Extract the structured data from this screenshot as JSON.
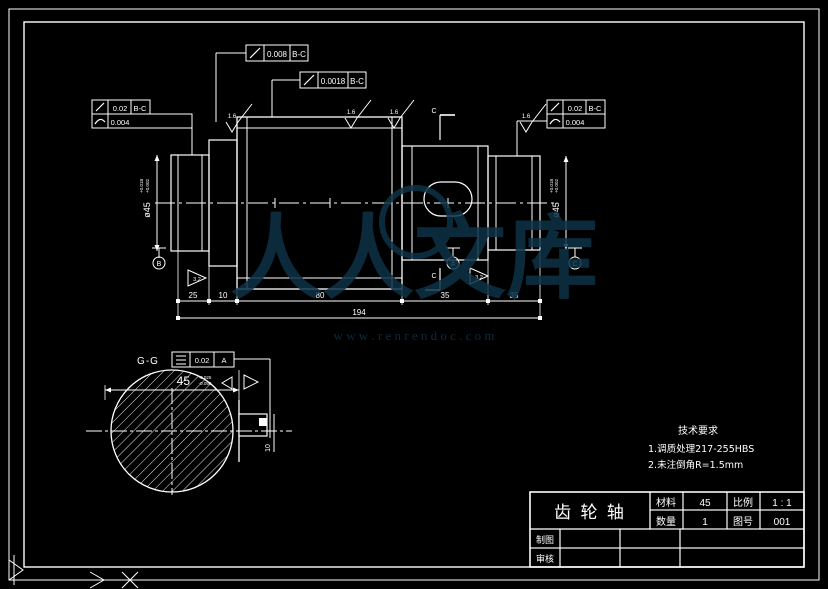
{
  "drawing": {
    "kind": "mechanical-engineering-part-drawing",
    "background_color": "#000000",
    "line_color": "#ffffff",
    "center_line_color": "#ffffff",
    "watermark_color": "#0d3348",
    "border": {
      "outer_label": "drawing-sheet-border",
      "inner_label": "drawing-frame"
    }
  },
  "watermark": {
    "logo_text": "人人文库",
    "url_text": "w w w . r e n r e n d o c . c o m"
  },
  "tolerance_frames": {
    "top_left": {
      "symbol": "⟋",
      "value": "0.008",
      "datum": "B-C"
    },
    "top_mid": {
      "symbol": "⟋",
      "value": "0.0018",
      "datum": "B-C"
    },
    "left_upper": {
      "symbol": "⟋",
      "value": "0.02",
      "datum": "B-C"
    },
    "left_lower": {
      "symbol": "⌓",
      "value": "0.004",
      "datum": ""
    },
    "right_upper": {
      "symbol": "⟋",
      "value": "0.02",
      "datum": "B-C"
    },
    "right_lower": {
      "symbol": "⌓",
      "value": "0.004",
      "datum": ""
    },
    "section_frame": {
      "symbol": "≡",
      "value": "0.02",
      "datum": "A"
    }
  },
  "datums": {
    "left": "B",
    "center": "A",
    "right": "C",
    "section_cut_left": "C",
    "section_cut_right": "C",
    "section_label": "G-G",
    "section_mark_left": "G",
    "section_mark_right": "G"
  },
  "surface_finish": {
    "values": [
      "1.6",
      "1.6",
      "1.6",
      "1.6",
      "3.2",
      "3.2"
    ],
    "symbol": "▽"
  },
  "dimensions": {
    "horizontal": [
      {
        "label": "25",
        "name": "dim-25"
      },
      {
        "label": "10",
        "name": "dim-10"
      },
      {
        "label": "80",
        "name": "dim-80"
      },
      {
        "label": "35",
        "name": "dim-35-a"
      },
      {
        "label": "35",
        "name": "dim-35-b"
      },
      {
        "label": "194",
        "name": "dim-overall-194"
      }
    ],
    "vertical_left": {
      "label": "ø45",
      "tolerance": "+0.018\n+0.002"
    },
    "vertical_right": {
      "label": "ø45",
      "tolerance": "+0.018\n+0.002"
    },
    "section_width": {
      "label": "45",
      "tolerance": "-0.025\n-0.050"
    },
    "keyway_depth": {
      "label": "10"
    }
  },
  "technical_requirements": {
    "title": "技术要求",
    "items": [
      "1.调质处理217-255HBS",
      "2.未注倒角R=1.5mm"
    ]
  },
  "title_block": {
    "part_name": "齿 轮 轴",
    "rows": [
      {
        "key": "材料",
        "value": "45",
        "key2": "比例",
        "value2": "1 : 1"
      },
      {
        "key": "数量",
        "value": "1",
        "key2": "图号",
        "value2": "001"
      }
    ],
    "sign_rows": [
      {
        "label": "制图",
        "c1": "",
        "c2": "",
        "c3": ""
      },
      {
        "label": "审核",
        "c1": "",
        "c2": "",
        "c3": ""
      }
    ]
  }
}
